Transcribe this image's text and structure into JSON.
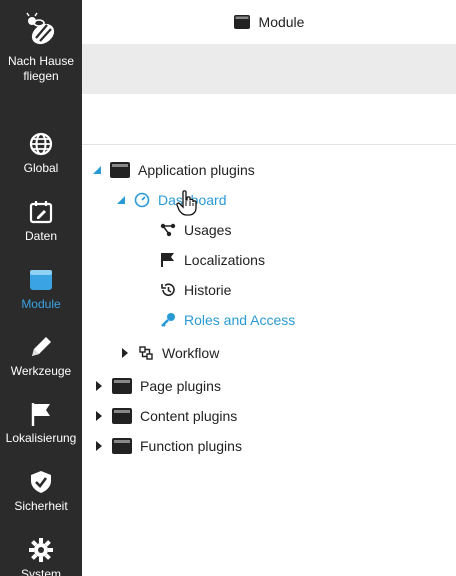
{
  "header": {
    "title": "Module",
    "icon": "module-icon"
  },
  "sidebar": {
    "accent": "#3aa3e3",
    "items": [
      {
        "label": "Nach Hause fliegen",
        "icon": "bee-icon"
      },
      {
        "label": "Global",
        "icon": "globe-icon"
      },
      {
        "label": "Daten",
        "icon": "calendar-edit-icon"
      },
      {
        "label": "Module",
        "icon": "module-icon",
        "active": true
      },
      {
        "label": "Werkzeuge",
        "icon": "pencil-icon"
      },
      {
        "label": "Lokalisierung",
        "icon": "flag-icon"
      },
      {
        "label": "Sicherheit",
        "icon": "shield-check-icon"
      },
      {
        "label": "System",
        "icon": "gear-icon"
      }
    ]
  },
  "tree": {
    "application_plugins": "Application plugins",
    "dashboard": "Dashboard",
    "usages": "Usages",
    "localizations": "Localizations",
    "historie": "Historie",
    "roles_and_access": "Roles and Access",
    "workflow": "Workflow",
    "page_plugins": "Page plugins",
    "content_plugins": "Content plugins",
    "function_plugins": "Function plugins",
    "link_color": "#2a9ad6"
  }
}
